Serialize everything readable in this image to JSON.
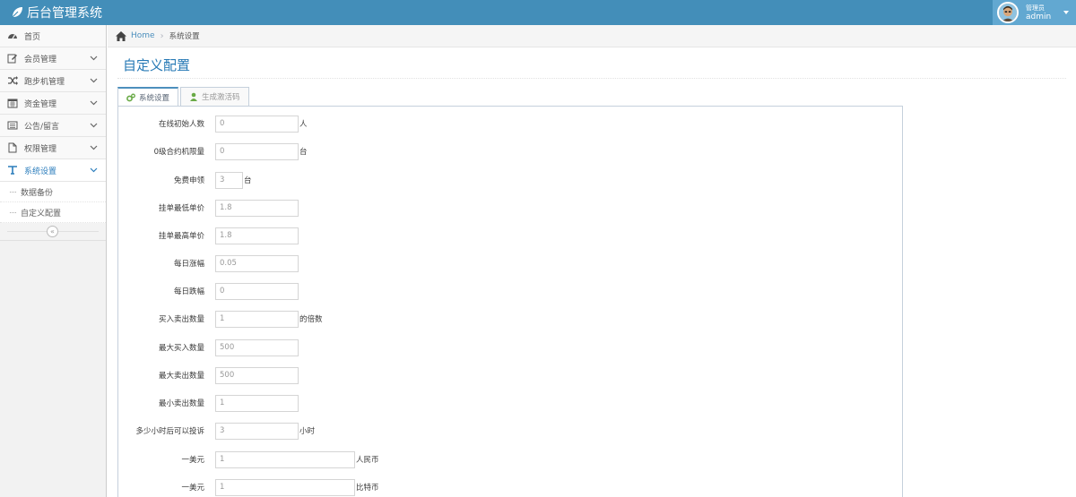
{
  "app": {
    "title": "后台管理系统"
  },
  "user": {
    "role": "管理员",
    "name": "admin"
  },
  "sidebar": {
    "items": [
      {
        "label": "首页",
        "icon": "dashboard-icon"
      },
      {
        "label": "会员管理",
        "icon": "edit-icon"
      },
      {
        "label": "跑步机管理",
        "icon": "shuffle-icon"
      },
      {
        "label": "资金管理",
        "icon": "calendar-icon"
      },
      {
        "label": "公告/留言",
        "icon": "list-alt-icon"
      },
      {
        "label": "权限管理",
        "icon": "file-icon"
      },
      {
        "label": "系统设置",
        "icon": "text-width-icon"
      }
    ],
    "subitems": [
      "数据备份",
      "自定义配置"
    ],
    "collapse": "«"
  },
  "breadcrumb": {
    "home": "Home",
    "current": "系统设置"
  },
  "page": {
    "title": "自定义配置"
  },
  "tabs": [
    "系统设置",
    "生成激活码"
  ],
  "form": [
    {
      "label": "在线初始人数",
      "value": "0",
      "unit": "人"
    },
    {
      "label": "0级合约机限量",
      "value": "0",
      "unit": "台"
    },
    {
      "label": "免费申领",
      "value": "3",
      "unit": "台"
    },
    {
      "label": "挂单最低单价",
      "value": "1.8",
      "unit": ""
    },
    {
      "label": "挂单最高单价",
      "value": "1.8",
      "unit": ""
    },
    {
      "label": "每日涨幅",
      "value": "0.05",
      "unit": ""
    },
    {
      "label": "每日跌幅",
      "value": "0",
      "unit": ""
    },
    {
      "label": "买入卖出数量",
      "value": "1",
      "unit": "的倍数"
    },
    {
      "label": "最大买入数量",
      "value": "500",
      "unit": ""
    },
    {
      "label": "最大卖出数量",
      "value": "500",
      "unit": ""
    },
    {
      "label": "最小卖出数量",
      "value": "1",
      "unit": ""
    },
    {
      "label": "多少小时后可以投诉",
      "value": "3",
      "unit": "小时"
    },
    {
      "label": "一美元",
      "value": "1",
      "unit": "人民币"
    },
    {
      "label": "一美元",
      "value": "1",
      "unit": "比特币"
    }
  ],
  "colors": {
    "navbar": "#438eb9",
    "accent": "#2679b5",
    "link": "#4c8fbd"
  }
}
